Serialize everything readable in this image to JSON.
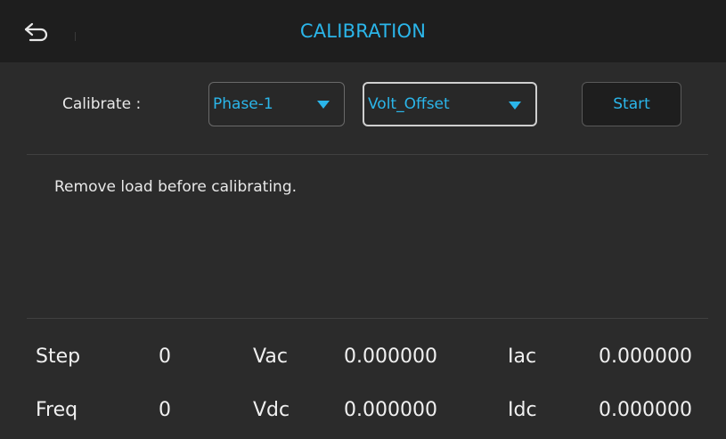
{
  "header": {
    "title": "CALIBRATION",
    "back_icon": "back-arrow-icon"
  },
  "calibrate": {
    "label": "Calibrate :",
    "phase_select": {
      "value": "Phase-1"
    },
    "mode_select": {
      "value": "Volt_Offset"
    },
    "start_label": "Start"
  },
  "message": "Remove load before calibrating.",
  "readouts": {
    "row1": {
      "label1": "Step",
      "value1": "0",
      "label2": "Vac",
      "value2": "0.000000",
      "label3": "Iac",
      "value3": "0.000000"
    },
    "row2": {
      "label1": "Freq",
      "value1": "0",
      "label2": "Vdc",
      "value2": "0.000000",
      "label3": "Idc",
      "value3": "0.000000"
    }
  },
  "colors": {
    "accent": "#2bb6ea",
    "header_bg": "#1e1e1e",
    "body_bg": "#2b2b2b"
  }
}
